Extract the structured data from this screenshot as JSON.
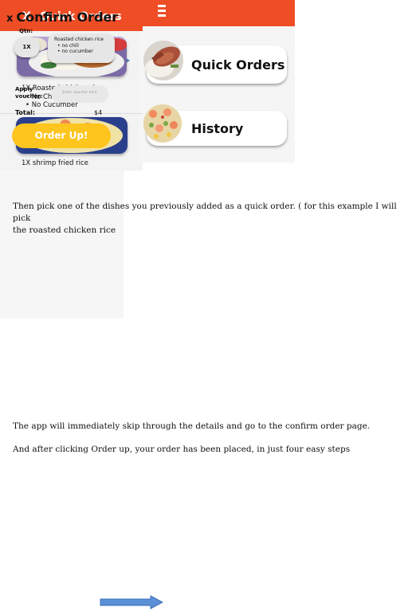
{
  "screen1": {
    "quick_orders_label": "Quick Orders",
    "history_label": "History",
    "accent_color": "#ef4d25"
  },
  "instructions": {
    "para1_line1": "Then pick one of the dishes you previously added as a quick order. ( for this example I will pick",
    "para1_line2": "the roasted chicken rice",
    "para2": "The app will immediately skip through the details and go to the confirm order page.",
    "para3": "And after clicking Order up, your order has been placed, in just four easy steps"
  },
  "screen2": {
    "close": "X",
    "title": "Quick Orders",
    "items": [
      {
        "name": "1X Roasted chicken rice",
        "options": [
          "No Chili",
          "No Cucumber"
        ]
      },
      {
        "name": "1X shrimp fried rice",
        "options": []
      }
    ]
  },
  "screen3": {
    "close": "x",
    "title": "Confirm Order",
    "qtn_label": "Qtn:",
    "qty": "1X",
    "item_name": "Roasted chicken rice",
    "item_options": [
      "no chili",
      "no cucumber"
    ],
    "voucher_label_1": "Apply",
    "voucher_label_2": "voucher:",
    "voucher_placeholder": "Enter voucher here",
    "total_label": "Total:",
    "total_value": "$4",
    "order_button": "Order Up!",
    "button_color": "#ffc51f"
  },
  "icons": [
    "menu-icon",
    "arrow-right-icon"
  ]
}
